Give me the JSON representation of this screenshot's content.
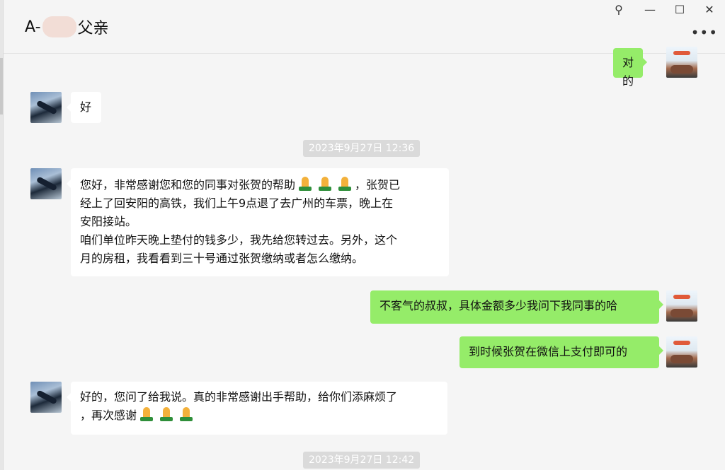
{
  "header": {
    "title_prefix": "A-",
    "title_suffix": "父亲",
    "pin_icon": "pin-icon",
    "minimize_icon": "minimize-icon",
    "maximize_icon": "maximize-icon",
    "close_icon": "close-icon",
    "more_icon": "more-icon",
    "pin_glyph": "⚲",
    "minimize_glyph": "—",
    "maximize_glyph": "☐",
    "close_glyph": "✕",
    "more_glyph": "•••"
  },
  "colors": {
    "outgoing_bubble": "#95ec69",
    "incoming_bubble": "#ffffff",
    "background": "#f5f5f5",
    "timestamp_bg": "#dadada"
  },
  "messages": [
    {
      "from": "self",
      "text": "对的"
    },
    {
      "from": "other",
      "text": "好"
    },
    {
      "type": "timestamp",
      "text": "2023年9月27日 12:36"
    },
    {
      "from": "other",
      "line1a": "您好，非常感谢您和您的同事对张贺的帮助",
      "line1b": "，张贺已",
      "line2": "经上了回安阳的高铁，我们上午9点退了去广州的车票，晚上在",
      "line3": "安阳接站。",
      "line4": "咱们单位昨天晚上垫付的钱多少，我先给您转过去。另外，这个",
      "line5": "月的房租，我看看到三十号通过张贺缴纳或者怎么缴纳。"
    },
    {
      "from": "self",
      "text": "不客气的叔叔，具体金额多少我问下我同事的哈"
    },
    {
      "from": "self",
      "text": "到时候张贺在微信上支付即可的"
    },
    {
      "from": "other",
      "line1": "好的，您问了给我说。真的非常感谢出手帮助，给你们添麻烦了",
      "line2": "，再次感谢"
    },
    {
      "type": "timestamp",
      "text": "2023年9月27日 12:42"
    }
  ],
  "emoji": {
    "pray": "folded-hands-icon"
  }
}
